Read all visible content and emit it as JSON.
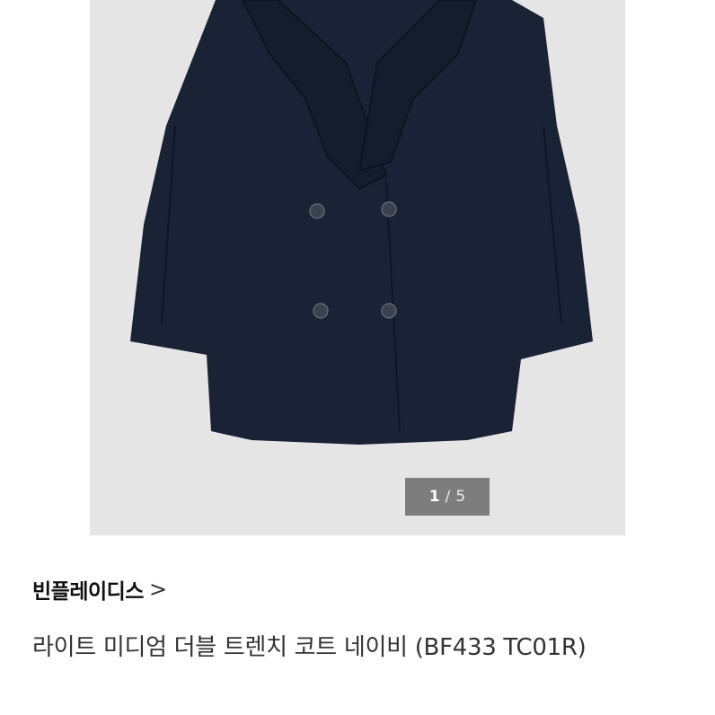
{
  "product_image": {
    "alt": "navy double-breasted coat",
    "coat_color": "#1a2236",
    "background_color": "#e5e5e5"
  },
  "pager": {
    "current": "1",
    "separator": "/",
    "total": "5"
  },
  "brand": {
    "name": "빈플레이디스",
    "chevron": ">"
  },
  "product": {
    "title": "라이트 미디엄 더블 트렌치 코트 네이비 (BF433 TC01R)"
  }
}
